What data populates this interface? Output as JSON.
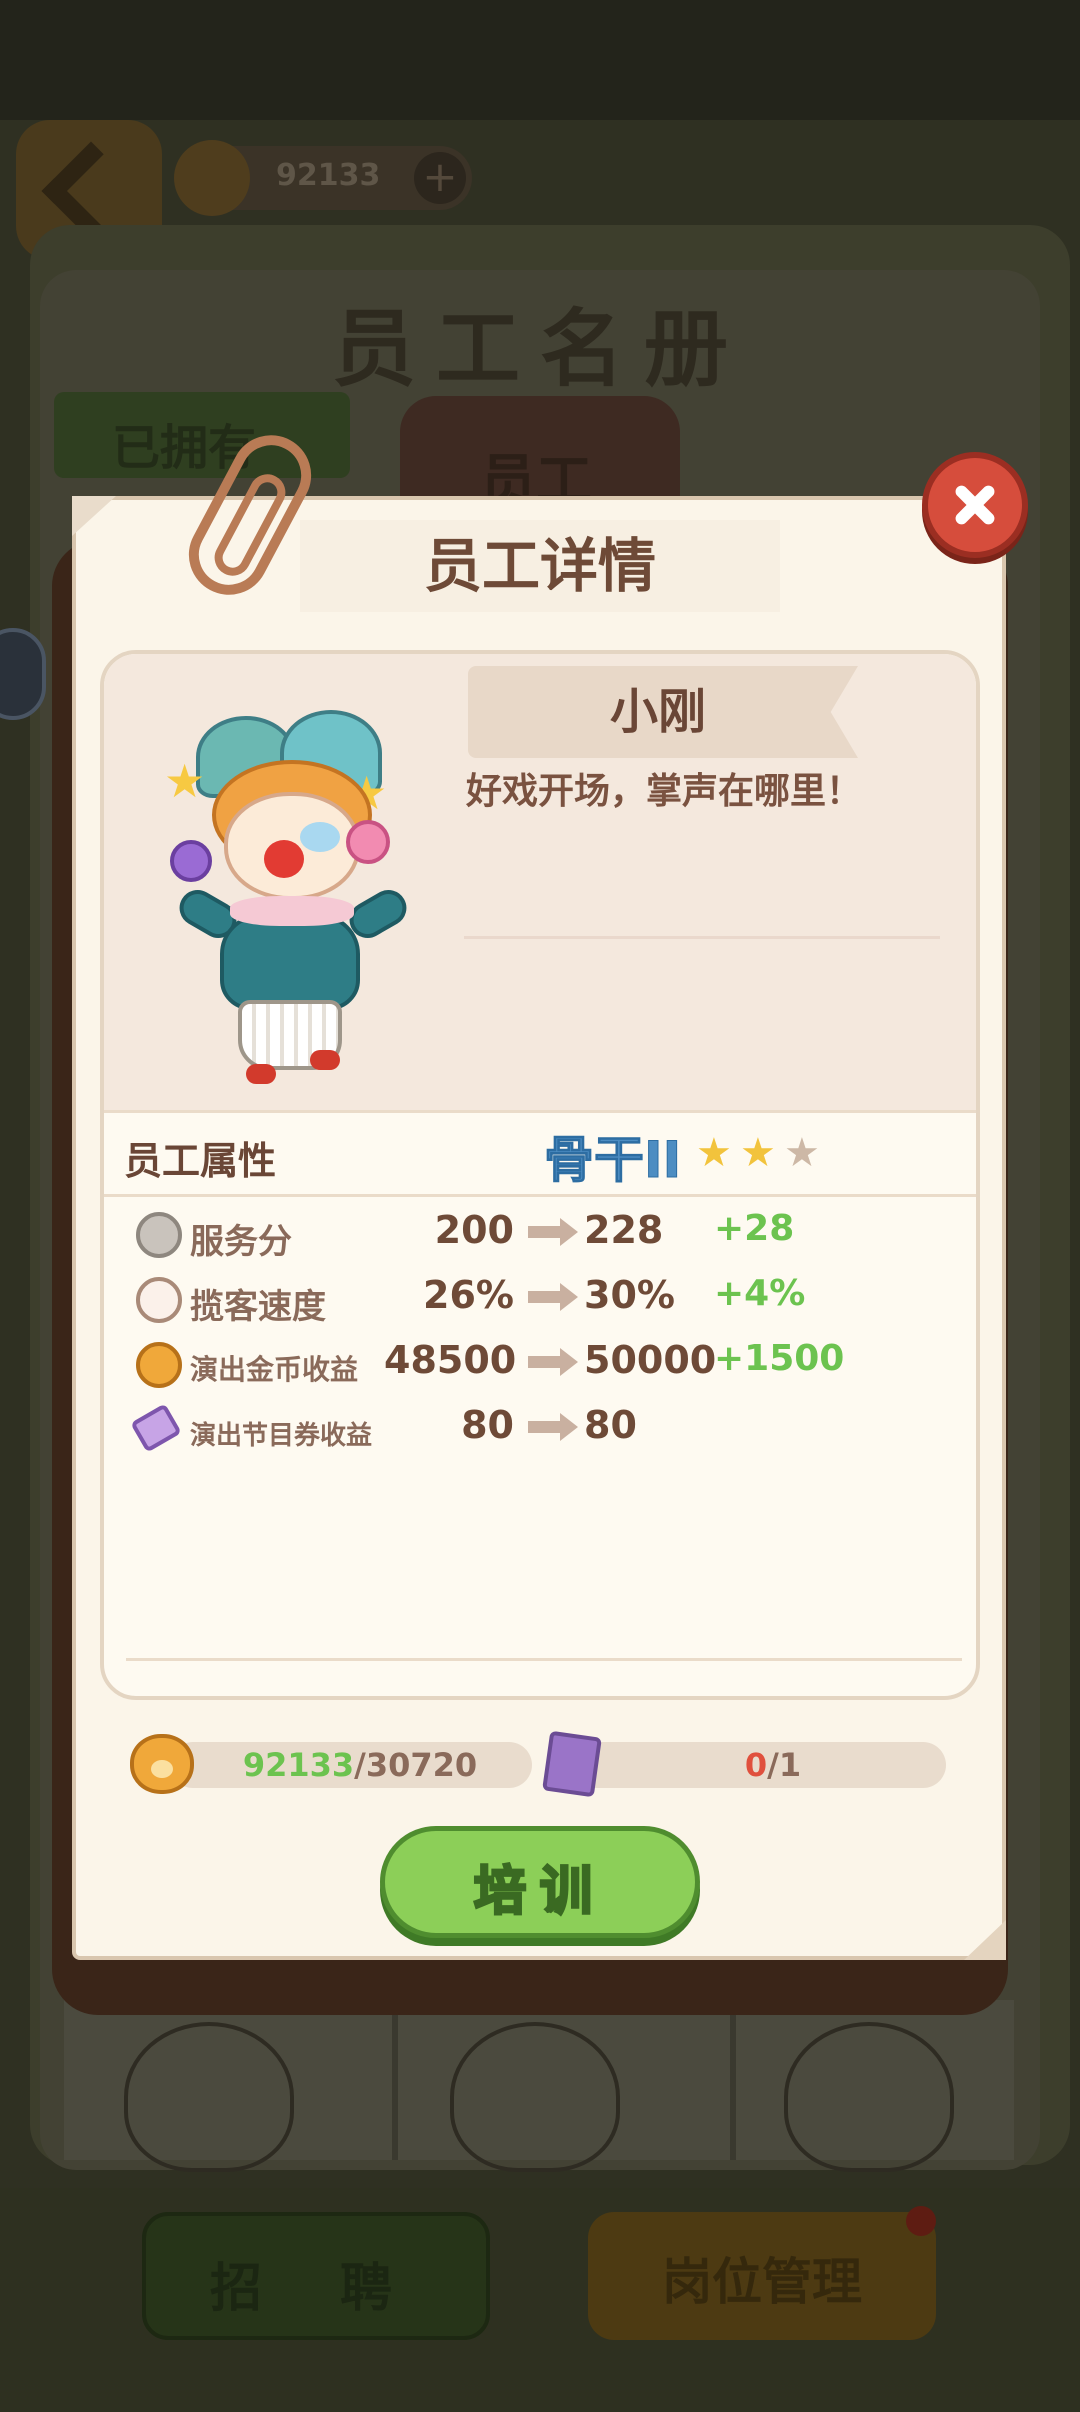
{
  "background": {
    "coin_count": "92133",
    "title": "员工名册",
    "tab_owned": "已拥有",
    "tab_staff": "员工",
    "recruit_label": "招 聘",
    "post_manage_label": "岗位管理"
  },
  "dialog": {
    "title": "员工详情",
    "name": "小刚",
    "motto": "好戏开场，掌声在哪里！",
    "attr_title": "员工属性",
    "rank": "骨干II",
    "rank_stars": {
      "filled": 2,
      "total": 3
    },
    "stats": [
      {
        "icon": "service-bell-icon",
        "label": "服务分",
        "from": "200",
        "to": "228",
        "diff": "+28"
      },
      {
        "icon": "paw-glove-icon",
        "label": "揽客速度",
        "from": "26%",
        "to": "30%",
        "diff": "+4%"
      },
      {
        "icon": "paw-coin-icon",
        "label": "演出金币收益",
        "from": "48500",
        "to": "50000",
        "diff": "+1500"
      },
      {
        "icon": "ticket-icon",
        "label": "演出节目券收益",
        "from": "80",
        "to": "80",
        "diff": ""
      }
    ],
    "resources": {
      "coin_have": "92133",
      "coin_need": "/30720",
      "book_have": "0",
      "book_need": "/1"
    },
    "train_label": "培训"
  },
  "colors": {
    "accent_green": "#6cc34f",
    "warning_red": "#e0503d",
    "text_brown": "#6e4a37",
    "close_red": "#d64d3c"
  }
}
